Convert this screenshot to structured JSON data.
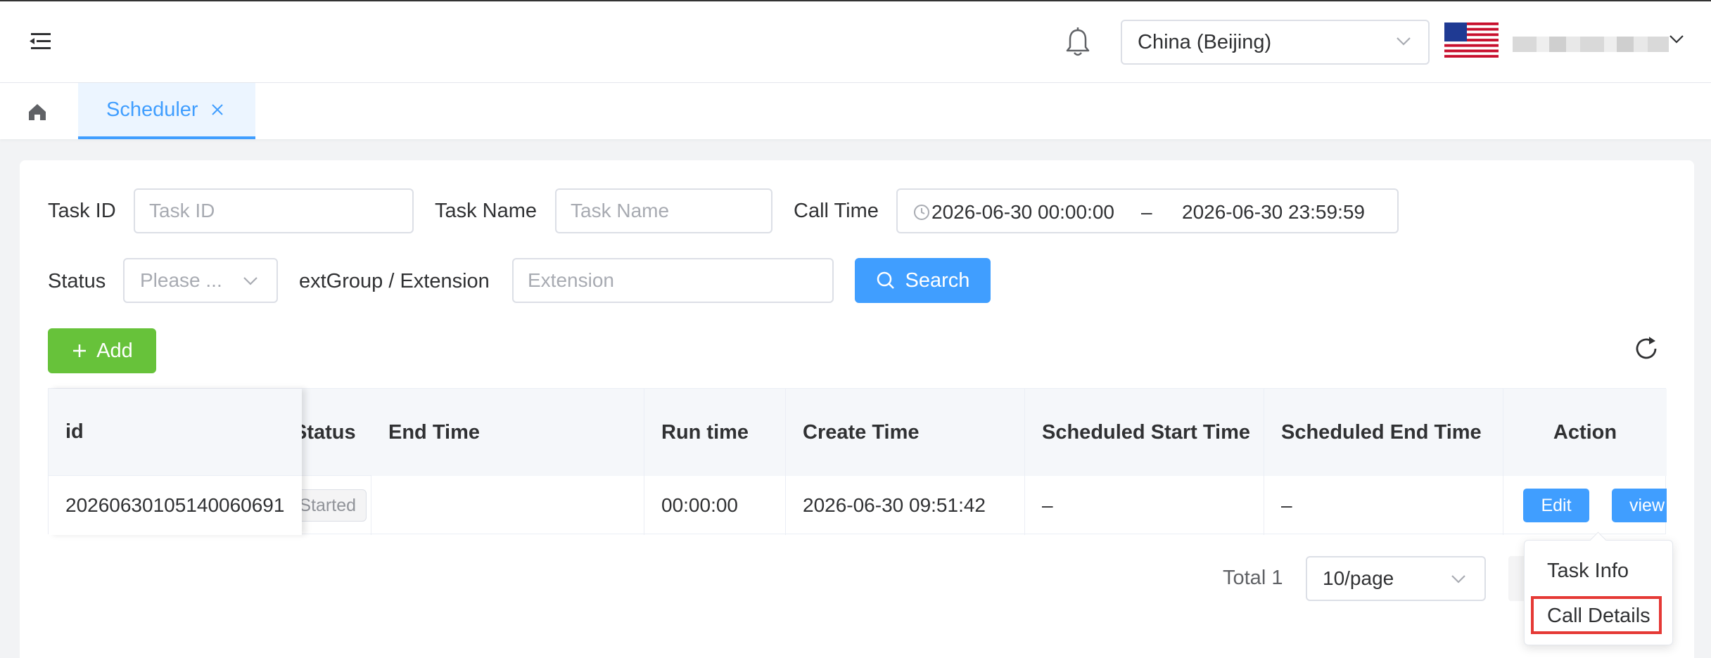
{
  "header": {
    "region": "China (Beijing)",
    "user_name": ""
  },
  "tabs": {
    "active_label": "Scheduler"
  },
  "filters": {
    "task_id_label": "Task ID",
    "task_id_placeholder": "Task ID",
    "task_name_label": "Task Name",
    "task_name_placeholder": "Task Name",
    "call_time_label": "Call Time",
    "call_time_start": "2026-06-30 00:00:00",
    "call_time_separator": "–",
    "call_time_end": "2026-06-30 23:59:59",
    "status_label": "Status",
    "status_placeholder": "Please ...",
    "ext_label": "extGroup / Extension",
    "ext_placeholder": "Extension",
    "search_label": "Search"
  },
  "toolbar": {
    "add_label": "Add"
  },
  "table": {
    "columns": [
      "id",
      "Status",
      "End Time",
      "Run time",
      "Create Time",
      "Scheduled Start Time",
      "Scheduled End Time",
      "Action"
    ],
    "rows": [
      {
        "id": "20260630105140060691",
        "status": "Not Started",
        "end_time": "",
        "run_time": "00:00:00",
        "create_time": "2026-06-30 09:51:42",
        "scheduled_start": "–",
        "scheduled_end": "–",
        "edit_label": "Edit",
        "view_label": "view"
      }
    ]
  },
  "pagination": {
    "total_text": "Total 1",
    "page_size": "10/page"
  },
  "dropdown": {
    "items": [
      "Task Info",
      "Call Details"
    ]
  },
  "colors": {
    "primary": "#409eff",
    "success": "#67c23a",
    "highlight": "#e53935"
  }
}
